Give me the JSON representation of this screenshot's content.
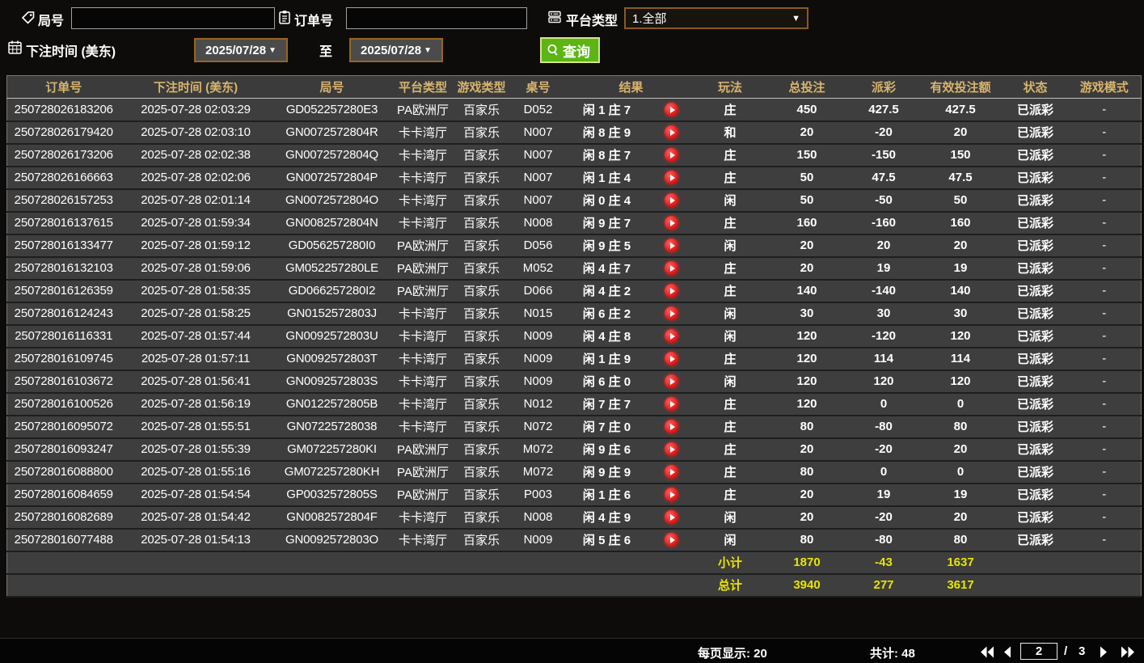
{
  "filters": {
    "round_label": "局号",
    "order_label": "订单号",
    "platform_label": "平台类型",
    "platform_value": "1.全部",
    "bet_time_label": "下注时间 (美东)",
    "date_from": "2025/07/28",
    "date_to": "2025/07/28",
    "to_label": "至",
    "query_label": "查询"
  },
  "colors": {
    "header_gold": "#d8b46e",
    "payout_positive_red": "#a51c30",
    "payout_negative_green": "#7fd800",
    "status_green": "#2fd32f",
    "totals_yellow": "#e8e400",
    "query_button_green": "#5cb515",
    "date_border_orange": "#96661c",
    "row_background": "#3e3e3e"
  },
  "table": {
    "headers": [
      "订单号",
      "下注时间 (美东)",
      "局号",
      "平台类型",
      "游戏类型",
      "桌号",
      "结果",
      "玩法",
      "总投注",
      "派彩",
      "有效投注额",
      "状态",
      "游戏模式"
    ],
    "rows": [
      {
        "order": "250728026183206",
        "time": "2025-07-28 02:03:29",
        "round": "GD052257280E3",
        "platform": "PA欧洲厅",
        "game": "百家乐",
        "table": "D052",
        "result": "闲 1 庄 7",
        "playtype": "庄",
        "bet": "450",
        "payout": "427.5",
        "payout_type": "pos",
        "valid": "427.5",
        "status": "已派彩",
        "mode": "-"
      },
      {
        "order": "250728026179420",
        "time": "2025-07-28 02:03:10",
        "round": "GN0072572804R",
        "platform": "卡卡湾厅",
        "game": "百家乐",
        "table": "N007",
        "result": "闲 8 庄 9",
        "playtype": "和",
        "bet": "20",
        "payout": "-20",
        "payout_type": "neg",
        "valid": "20",
        "status": "已派彩",
        "mode": "-"
      },
      {
        "order": "250728026173206",
        "time": "2025-07-28 02:02:38",
        "round": "GN0072572804Q",
        "platform": "卡卡湾厅",
        "game": "百家乐",
        "table": "N007",
        "result": "闲 8 庄 7",
        "playtype": "庄",
        "bet": "150",
        "payout": "-150",
        "payout_type": "neg",
        "valid": "150",
        "status": "已派彩",
        "mode": "-"
      },
      {
        "order": "250728026166663",
        "time": "2025-07-28 02:02:06",
        "round": "GN0072572804P",
        "platform": "卡卡湾厅",
        "game": "百家乐",
        "table": "N007",
        "result": "闲 1 庄 4",
        "playtype": "庄",
        "bet": "50",
        "payout": "47.5",
        "payout_type": "pos",
        "valid": "47.5",
        "status": "已派彩",
        "mode": "-"
      },
      {
        "order": "250728026157253",
        "time": "2025-07-28 02:01:14",
        "round": "GN0072572804O",
        "platform": "卡卡湾厅",
        "game": "百家乐",
        "table": "N007",
        "result": "闲 0 庄 4",
        "playtype": "闲",
        "bet": "50",
        "payout": "-50",
        "payout_type": "neg",
        "valid": "50",
        "status": "已派彩",
        "mode": "-"
      },
      {
        "order": "250728016137615",
        "time": "2025-07-28 01:59:34",
        "round": "GN0082572804N",
        "platform": "卡卡湾厅",
        "game": "百家乐",
        "table": "N008",
        "result": "闲 9 庄 7",
        "playtype": "庄",
        "bet": "160",
        "payout": "-160",
        "payout_type": "neg",
        "valid": "160",
        "status": "已派彩",
        "mode": "-"
      },
      {
        "order": "250728016133477",
        "time": "2025-07-28 01:59:12",
        "round": "GD056257280I0",
        "platform": "PA欧洲厅",
        "game": "百家乐",
        "table": "D056",
        "result": "闲 9 庄 5",
        "playtype": "闲",
        "bet": "20",
        "payout": "20",
        "payout_type": "pos",
        "valid": "20",
        "status": "已派彩",
        "mode": "-"
      },
      {
        "order": "250728016132103",
        "time": "2025-07-28 01:59:06",
        "round": "GM052257280LE",
        "platform": "PA欧洲厅",
        "game": "百家乐",
        "table": "M052",
        "result": "闲 4 庄 7",
        "playtype": "庄",
        "bet": "20",
        "payout": "19",
        "payout_type": "pos",
        "valid": "19",
        "status": "已派彩",
        "mode": "-"
      },
      {
        "order": "250728016126359",
        "time": "2025-07-28 01:58:35",
        "round": "GD066257280I2",
        "platform": "PA欧洲厅",
        "game": "百家乐",
        "table": "D066",
        "result": "闲 4 庄 2",
        "playtype": "庄",
        "bet": "140",
        "payout": "-140",
        "payout_type": "neg",
        "valid": "140",
        "status": "已派彩",
        "mode": "-"
      },
      {
        "order": "250728016124243",
        "time": "2025-07-28 01:58:25",
        "round": "GN0152572803J",
        "platform": "卡卡湾厅",
        "game": "百家乐",
        "table": "N015",
        "result": "闲 6 庄 2",
        "playtype": "闲",
        "bet": "30",
        "payout": "30",
        "payout_type": "pos",
        "valid": "30",
        "status": "已派彩",
        "mode": "-"
      },
      {
        "order": "250728016116331",
        "time": "2025-07-28 01:57:44",
        "round": "GN0092572803U",
        "platform": "卡卡湾厅",
        "game": "百家乐",
        "table": "N009",
        "result": "闲 4 庄 8",
        "playtype": "闲",
        "bet": "120",
        "payout": "-120",
        "payout_type": "neg",
        "valid": "120",
        "status": "已派彩",
        "mode": "-"
      },
      {
        "order": "250728016109745",
        "time": "2025-07-28 01:57:11",
        "round": "GN0092572803T",
        "platform": "卡卡湾厅",
        "game": "百家乐",
        "table": "N009",
        "result": "闲 1 庄 9",
        "playtype": "庄",
        "bet": "120",
        "payout": "114",
        "payout_type": "pos",
        "valid": "114",
        "status": "已派彩",
        "mode": "-"
      },
      {
        "order": "250728016103672",
        "time": "2025-07-28 01:56:41",
        "round": "GN0092572803S",
        "platform": "卡卡湾厅",
        "game": "百家乐",
        "table": "N009",
        "result": "闲 6 庄 0",
        "playtype": "闲",
        "bet": "120",
        "payout": "120",
        "payout_type": "pos",
        "valid": "120",
        "status": "已派彩",
        "mode": "-"
      },
      {
        "order": "250728016100526",
        "time": "2025-07-28 01:56:19",
        "round": "GN0122572805B",
        "platform": "卡卡湾厅",
        "game": "百家乐",
        "table": "N012",
        "result": "闲 7 庄 7",
        "playtype": "庄",
        "bet": "120",
        "payout": "0",
        "payout_type": "zero",
        "valid": "0",
        "status": "已派彩",
        "mode": "-"
      },
      {
        "order": "250728016095072",
        "time": "2025-07-28 01:55:51",
        "round": "GN07225728038",
        "platform": "卡卡湾厅",
        "game": "百家乐",
        "table": "N072",
        "result": "闲 7 庄 0",
        "playtype": "庄",
        "bet": "80",
        "payout": "-80",
        "payout_type": "neg",
        "valid": "80",
        "status": "已派彩",
        "mode": "-"
      },
      {
        "order": "250728016093247",
        "time": "2025-07-28 01:55:39",
        "round": "GM072257280KI",
        "platform": "PA欧洲厅",
        "game": "百家乐",
        "table": "M072",
        "result": "闲 9 庄 6",
        "playtype": "庄",
        "bet": "20",
        "payout": "-20",
        "payout_type": "neg",
        "valid": "20",
        "status": "已派彩",
        "mode": "-"
      },
      {
        "order": "250728016088800",
        "time": "2025-07-28 01:55:16",
        "round": "GM072257280KH",
        "platform": "PA欧洲厅",
        "game": "百家乐",
        "table": "M072",
        "result": "闲 9 庄 9",
        "playtype": "庄",
        "bet": "80",
        "payout": "0",
        "payout_type": "zero",
        "valid": "0",
        "status": "已派彩",
        "mode": "-"
      },
      {
        "order": "250728016084659",
        "time": "2025-07-28 01:54:54",
        "round": "GP0032572805S",
        "platform": "PA欧洲厅",
        "game": "百家乐",
        "table": "P003",
        "result": "闲 1 庄 6",
        "playtype": "庄",
        "bet": "20",
        "payout": "19",
        "payout_type": "pos",
        "valid": "19",
        "status": "已派彩",
        "mode": "-"
      },
      {
        "order": "250728016082689",
        "time": "2025-07-28 01:54:42",
        "round": "GN0082572804F",
        "platform": "卡卡湾厅",
        "game": "百家乐",
        "table": "N008",
        "result": "闲 4 庄 9",
        "playtype": "闲",
        "bet": "20",
        "payout": "-20",
        "payout_type": "neg",
        "valid": "20",
        "status": "已派彩",
        "mode": "-"
      },
      {
        "order": "250728016077488",
        "time": "2025-07-28 01:54:13",
        "round": "GN0092572803O",
        "platform": "卡卡湾厅",
        "game": "百家乐",
        "table": "N009",
        "result": "闲 5 庄 6",
        "playtype": "闲",
        "bet": "80",
        "payout": "-80",
        "payout_type": "neg",
        "valid": "80",
        "status": "已派彩",
        "mode": "-"
      }
    ],
    "subtotal": {
      "label": "小计",
      "bet": "1870",
      "payout": "-43",
      "valid": "1637"
    },
    "total": {
      "label": "总计",
      "bet": "3940",
      "payout": "277",
      "valid": "3617"
    }
  },
  "footer": {
    "per_page": "每页显示: 20",
    "total_count": "共计: 48",
    "page_value": "2",
    "page_sep": "/",
    "page_total": "3"
  }
}
